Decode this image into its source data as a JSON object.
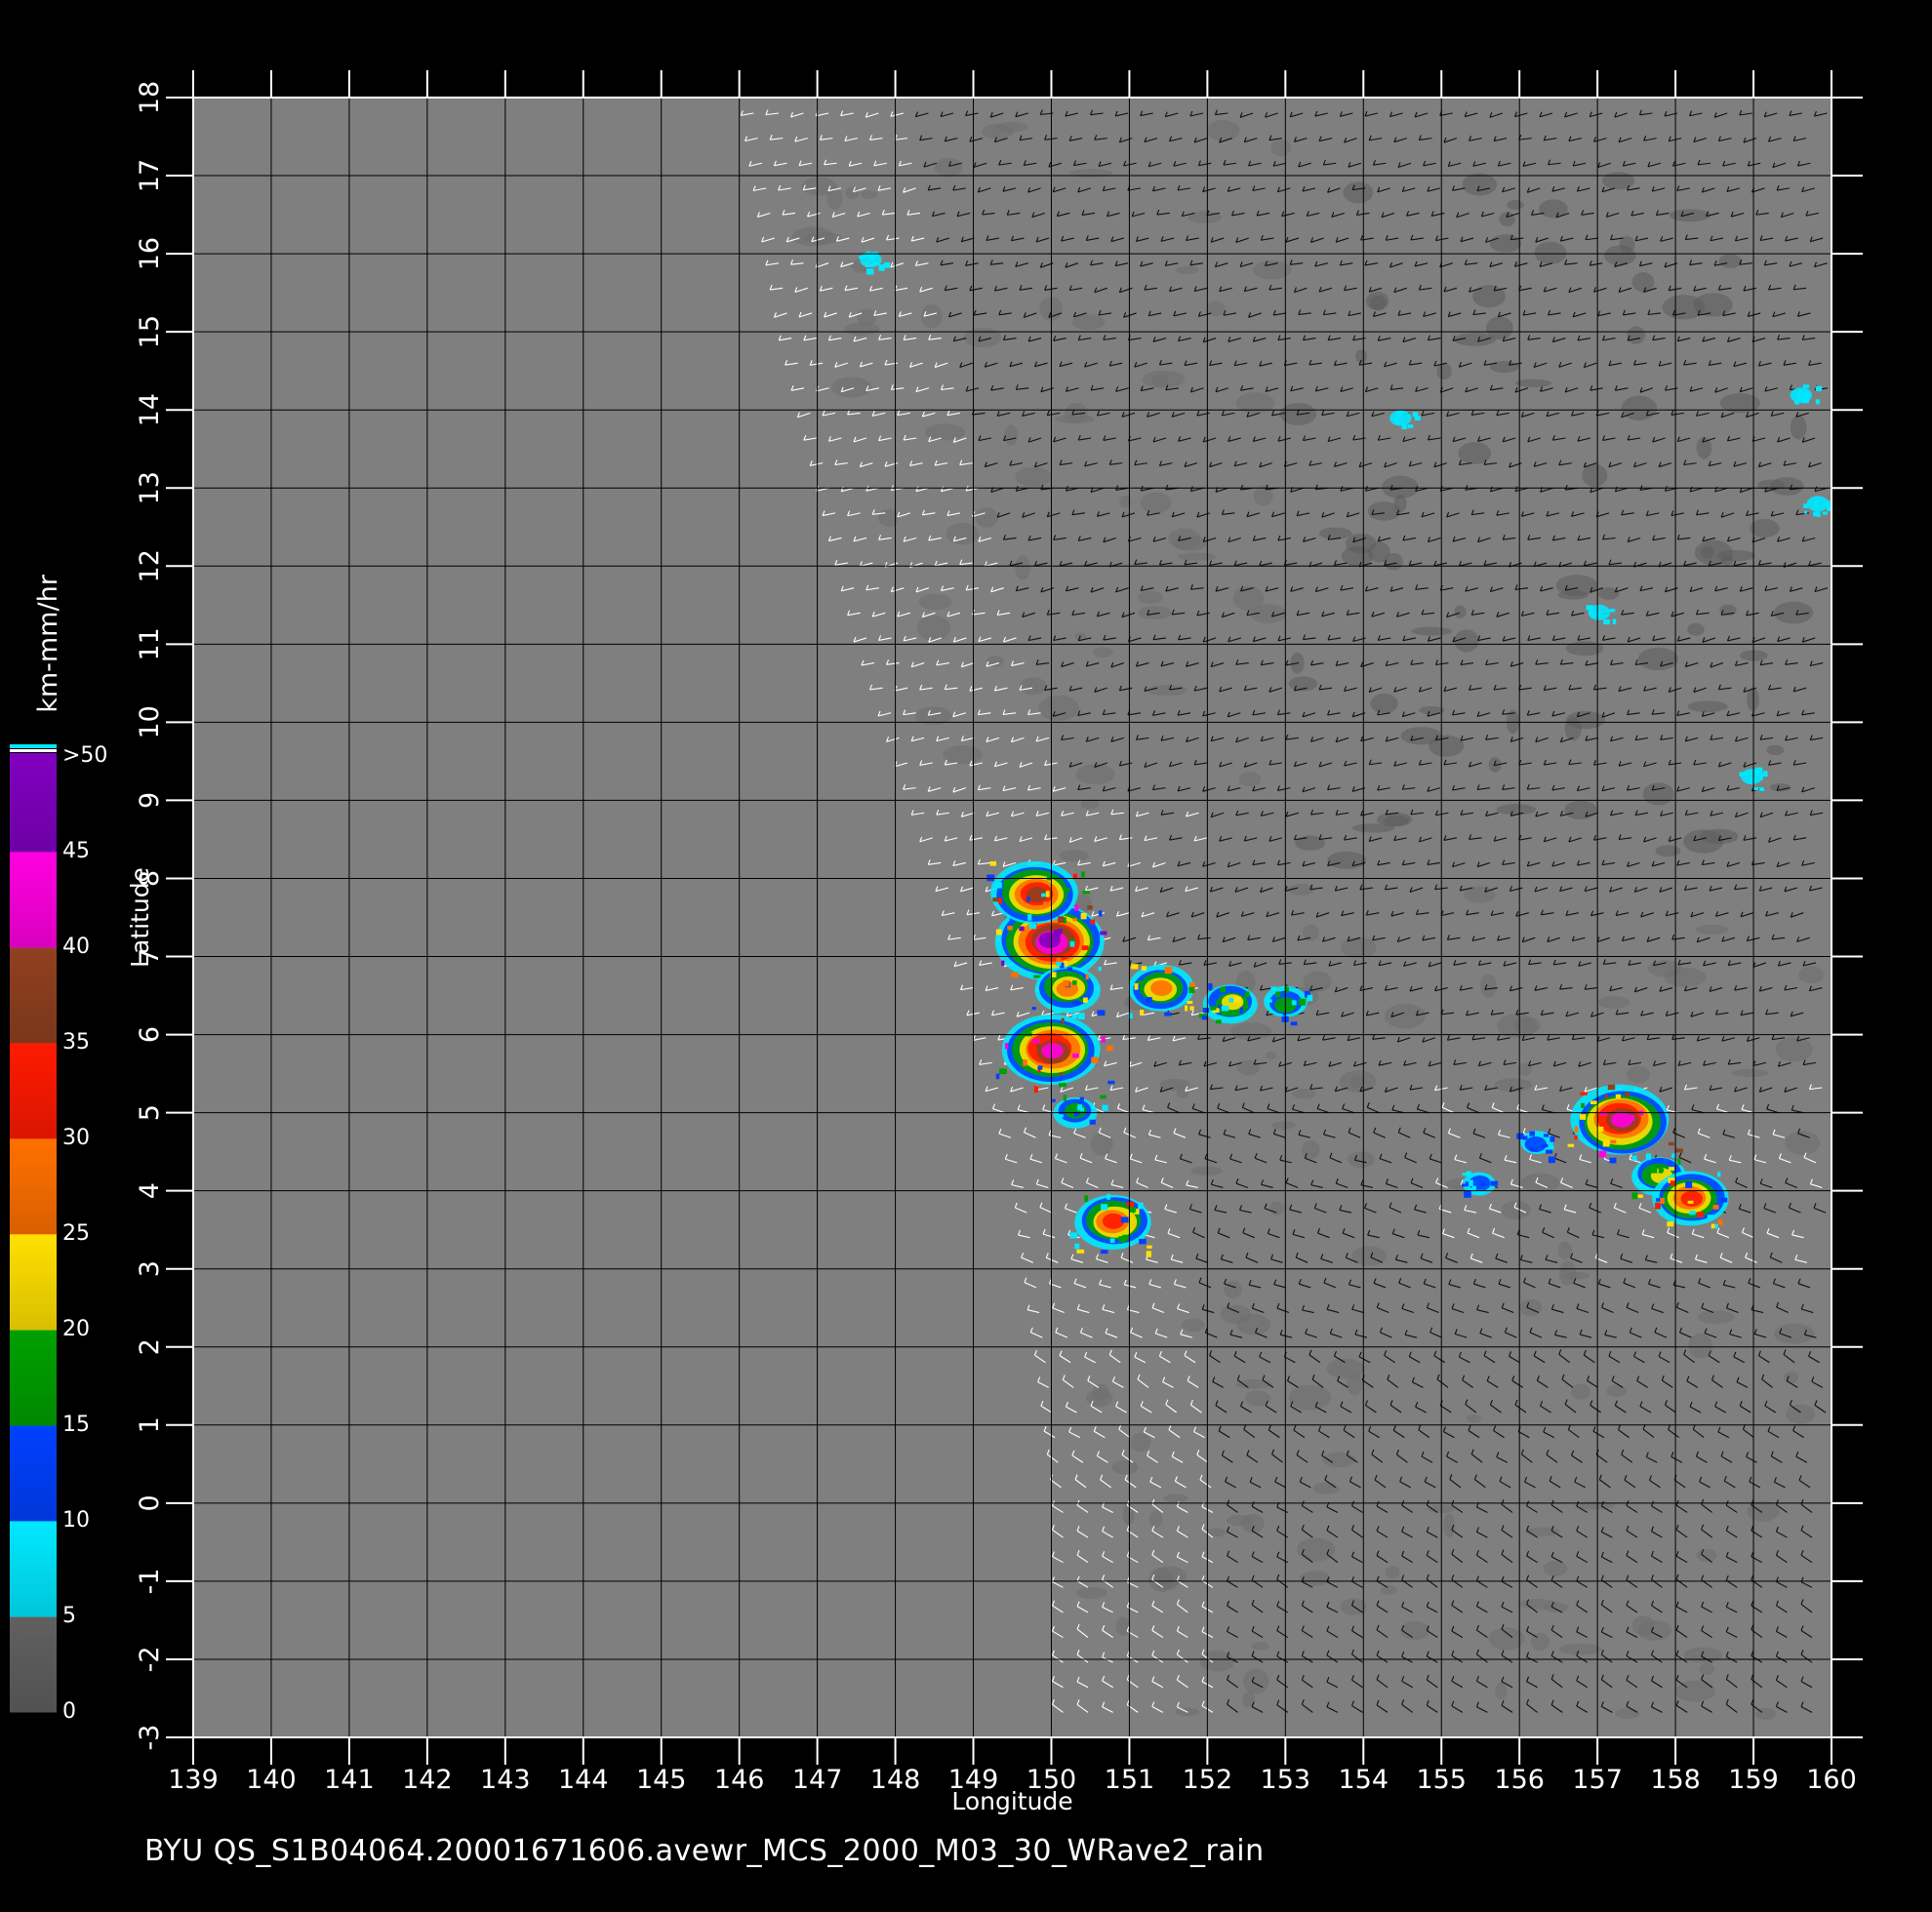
{
  "map": {
    "xlabel": "Longitude",
    "ylabel": "Latitude",
    "lon_range": [
      139,
      160
    ],
    "lat_range": [
      -3,
      18
    ],
    "lon_ticks": [
      "139",
      "140",
      "141",
      "142",
      "143",
      "144",
      "145",
      "146",
      "147",
      "148",
      "149",
      "150",
      "151",
      "152",
      "153",
      "154",
      "155",
      "156",
      "157",
      "158",
      "159",
      "160"
    ],
    "lat_ticks": [
      "-3",
      "-2",
      "-1",
      "0",
      "1",
      "2",
      "3",
      "4",
      "5",
      "6",
      "7",
      "8",
      "9",
      "10",
      "11",
      "12",
      "13",
      "14",
      "15",
      "16",
      "17",
      "18"
    ],
    "grid": true,
    "background_color": "#7f7f7f",
    "swath_approx_west_edge": [
      [
        146,
        18
      ],
      [
        146.5,
        15
      ],
      [
        147.5,
        11
      ],
      [
        148.5,
        8
      ],
      [
        149.5,
        4
      ],
      [
        150,
        0
      ],
      [
        150,
        -3
      ]
    ]
  },
  "colorbar": {
    "unit": "km-mm/hr",
    "labels": [
      "0",
      "5",
      "10",
      "15",
      "20",
      "25",
      "30",
      "35",
      "40",
      "45",
      ">50"
    ],
    "bands": [
      {
        "from": 0,
        "to": 5,
        "color": "#606060"
      },
      {
        "from": 5,
        "to": 10,
        "color": "#00e8ff"
      },
      {
        "from": 10,
        "to": 15,
        "color": "#0040ff"
      },
      {
        "from": 15,
        "to": 20,
        "color": "#00a000"
      },
      {
        "from": 20,
        "to": 25,
        "color": "#ffe000"
      },
      {
        "from": 25,
        "to": 30,
        "color": "#ff7000"
      },
      {
        "from": 30,
        "to": 35,
        "color": "#ff1a00"
      },
      {
        "from": 35,
        "to": 40,
        "color": "#904020"
      },
      {
        "from": 40,
        "to": 45,
        "color": "#ff00e0"
      },
      {
        "from": 45,
        "to": 50,
        "color": "#8000c0"
      }
    ]
  },
  "rain_cells": [
    {
      "lon": 150.0,
      "lat": 7.2,
      "level": 45
    },
    {
      "lon": 149.8,
      "lat": 7.8,
      "level": 35
    },
    {
      "lon": 150.2,
      "lat": 6.6,
      "level": 25
    },
    {
      "lon": 150.0,
      "lat": 5.8,
      "level": 40
    },
    {
      "lon": 150.3,
      "lat": 5.0,
      "level": 15
    },
    {
      "lon": 150.8,
      "lat": 3.6,
      "level": 30
    },
    {
      "lon": 151.4,
      "lat": 6.6,
      "level": 25
    },
    {
      "lon": 152.3,
      "lat": 6.4,
      "level": 20
    },
    {
      "lon": 153.0,
      "lat": 6.4,
      "level": 15
    },
    {
      "lon": 156.2,
      "lat": 4.6,
      "level": 10
    },
    {
      "lon": 157.3,
      "lat": 4.9,
      "level": 40
    },
    {
      "lon": 157.8,
      "lat": 4.2,
      "level": 20
    },
    {
      "lon": 158.2,
      "lat": 3.9,
      "level": 30
    },
    {
      "lon": 155.5,
      "lat": 4.1,
      "level": 10
    },
    {
      "lon": 154.5,
      "lat": 13.9,
      "level": 5
    },
    {
      "lon": 159.6,
      "lat": 14.2,
      "level": 5
    },
    {
      "lon": 159.8,
      "lat": 12.8,
      "level": 5
    },
    {
      "lon": 147.7,
      "lat": 15.9,
      "level": 5
    },
    {
      "lon": 157.0,
      "lat": 11.4,
      "level": 5
    },
    {
      "lon": 159.0,
      "lat": 9.3,
      "level": 5
    }
  ],
  "caption": "BYU  QS_S1B04064.20001671606.avewr_MCS_2000_M03_30_WRave2_rain"
}
